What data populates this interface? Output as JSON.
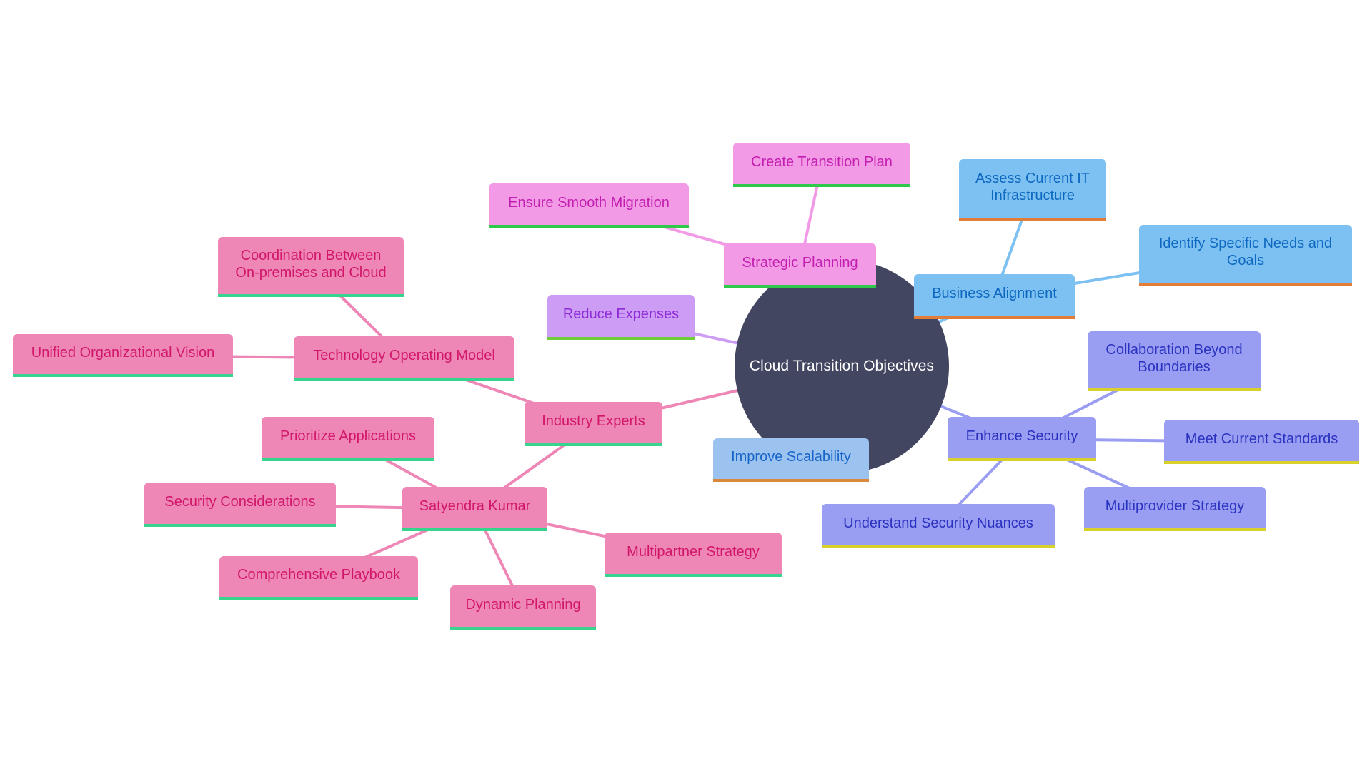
{
  "diagram": {
    "type": "mindmap",
    "root": {
      "id": "root",
      "label": "Cloud Transition Objectives"
    },
    "colors": {
      "root_fill": "#424660",
      "strategic_planning": {
        "fill": "#f39ae6",
        "text": "#c21fb0",
        "underline": "#2ec84a",
        "edge": "#f39ae6"
      },
      "business_alignment": {
        "fill": "#7cc1f2",
        "text": "#0e68c0",
        "underline": "#e27d38",
        "edge": "#7cc1f2"
      },
      "reduce_expenses": {
        "fill": "#cd9cf5",
        "text": "#8f2bd6",
        "underline": "#6fcd3c",
        "edge": "#cd9cf5"
      },
      "improve_scalability": {
        "fill": "#9cc2f0",
        "text": "#1765c8",
        "underline": "#d9883c",
        "edge": "#9cc2f0"
      },
      "enhance_security": {
        "fill": "#9a9ef2",
        "text": "#2a32c0",
        "underline": "#d8d12c",
        "edge": "#9a9ef2"
      },
      "industry_experts": {
        "fill": "#ee86b6",
        "text": "#d2166a",
        "underline": "#36d48c",
        "edge": "#ee86b6"
      }
    },
    "nodes": [
      {
        "id": "strategic",
        "label": "Strategic Planning",
        "parent": "root",
        "group": "strategic_planning"
      },
      {
        "id": "create-plan",
        "label": "Create Transition Plan",
        "parent": "strategic",
        "group": "strategic_planning"
      },
      {
        "id": "smooth-migration",
        "label": "Ensure Smooth Migration",
        "parent": "strategic",
        "group": "strategic_planning"
      },
      {
        "id": "business",
        "label": "Business Alignment",
        "parent": "root",
        "group": "business_alignment"
      },
      {
        "id": "assess-it",
        "label": "Assess Current IT Infrastructure",
        "parent": "business",
        "group": "business_alignment"
      },
      {
        "id": "identify-needs",
        "label": "Identify Specific Needs and Goals",
        "parent": "business",
        "group": "business_alignment"
      },
      {
        "id": "reduce",
        "label": "Reduce Expenses",
        "parent": "root",
        "group": "reduce_expenses"
      },
      {
        "id": "scalability",
        "label": "Improve Scalability",
        "parent": "root",
        "group": "improve_scalability"
      },
      {
        "id": "security",
        "label": "Enhance Security",
        "parent": "root",
        "group": "enhance_security"
      },
      {
        "id": "collab",
        "label": "Collaboration Beyond Boundaries",
        "parent": "security",
        "group": "enhance_security"
      },
      {
        "id": "standards",
        "label": "Meet Current Standards",
        "parent": "security",
        "group": "enhance_security"
      },
      {
        "id": "multiprovider",
        "label": "Multiprovider Strategy",
        "parent": "security",
        "group": "enhance_security"
      },
      {
        "id": "nuances",
        "label": "Understand Security Nuances",
        "parent": "security",
        "group": "enhance_security"
      },
      {
        "id": "experts",
        "label": "Industry Experts",
        "parent": "root",
        "group": "industry_experts"
      },
      {
        "id": "tom",
        "label": "Technology Operating Model",
        "parent": "experts",
        "group": "industry_experts"
      },
      {
        "id": "coordination",
        "label": "Coordination Between On-premises and Cloud",
        "parent": "tom",
        "group": "industry_experts"
      },
      {
        "id": "unified",
        "label": "Unified Organizational Vision",
        "parent": "tom",
        "group": "industry_experts"
      },
      {
        "id": "satyendra",
        "label": "Satyendra Kumar",
        "parent": "experts",
        "group": "industry_experts"
      },
      {
        "id": "prioritize",
        "label": "Prioritize Applications",
        "parent": "satyendra",
        "group": "industry_experts"
      },
      {
        "id": "sec-considerations",
        "label": "Security Considerations",
        "parent": "satyendra",
        "group": "industry_experts"
      },
      {
        "id": "playbook",
        "label": "Comprehensive Playbook",
        "parent": "satyendra",
        "group": "industry_experts"
      },
      {
        "id": "dynamic",
        "label": "Dynamic Planning",
        "parent": "satyendra",
        "group": "industry_experts"
      },
      {
        "id": "multipartner",
        "label": "Multipartner Strategy",
        "parent": "satyendra",
        "group": "industry_experts"
      }
    ]
  }
}
